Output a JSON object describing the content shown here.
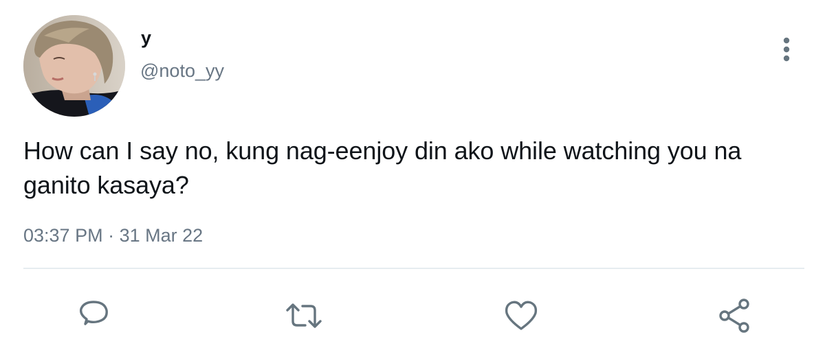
{
  "tweet": {
    "display_name": "y",
    "handle": "@noto_yy",
    "text": "How can I say no, kung nag-eenjoy din ako while watching you na ganito kasaya?",
    "time": "03:37 PM",
    "separator": "·",
    "date": "31 Mar 22"
  },
  "icons": {
    "more": "more-vertical-icon",
    "reply": "reply-icon",
    "retweet": "retweet-icon",
    "like": "heart-icon",
    "share": "share-icon"
  },
  "colors": {
    "text": "#0f1419",
    "secondary": "#687684",
    "icon": "#66757f",
    "divider": "#e6ecf0"
  }
}
